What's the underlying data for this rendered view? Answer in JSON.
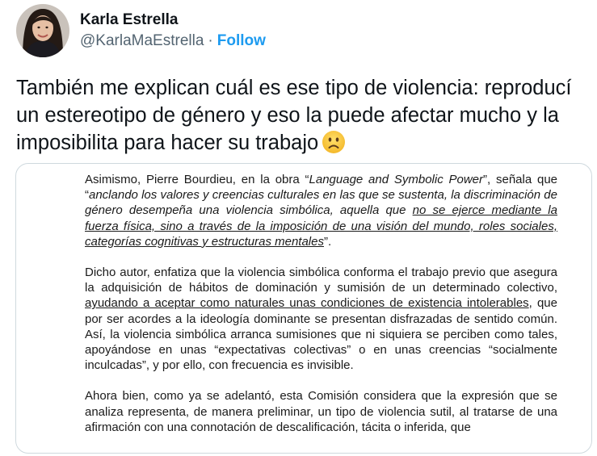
{
  "author": {
    "display_name": "Karla Estrella",
    "handle": "@KarlaMaEstrella",
    "separator": "·",
    "follow_label": "Follow",
    "avatar_icon": "profile-photo"
  },
  "tweet": {
    "text": "También me explican cuál es ese tipo de violencia: reproducí un estereotipo de género y eso la puede afectar mucho y la imposibilita para hacer su trabajo",
    "emoji": "slightly-frowning-face-icon"
  },
  "document": {
    "p1": {
      "a": "Asimismo, Pierre Bourdieu, en la obra “",
      "b": "Language and Symbolic Power",
      "c": "”, señala que “",
      "d": "anclando los valores y creencias culturales en las que se sustenta, la discriminación de género desempeña una violencia simbólica, aquella que ",
      "e": "no se ejerce mediante la fuerza física, sino a través de la imposición de una visión del mundo, roles sociales, categorías cognitivas y estructuras mentales",
      "f": "”."
    },
    "p2": {
      "a": "Dicho autor, enfatiza que la violencia simbólica conforma el trabajo previo que asegura la adquisición de hábitos de dominación y sumisión de un determinado colectivo, ",
      "b": "ayudando a aceptar como naturales unas condiciones de existencia intolerables",
      "c": ", que por ser acordes a la ideología dominante se presentan disfrazadas de sentido común. Así, la violencia simbólica arranca sumisiones que ni siquiera se perciben como tales, apoyándose en unas “expectativas colectivas” o en unas creencias “socialmente inculcadas”, y por ello, con frecuencia es invisible."
    },
    "p3": "Ahora bien, como ya se adelantó, esta Comisión considera que la expresión que se analiza representa, de manera preliminar, un tipo de violencia sutil, al tratarse de una afirmación con una connotación de descalificación, tácita o inferida, que"
  },
  "colors": {
    "text": "#0f1419",
    "secondary": "#536471",
    "accent": "#1d9bf0",
    "border": "#cfd9de"
  }
}
